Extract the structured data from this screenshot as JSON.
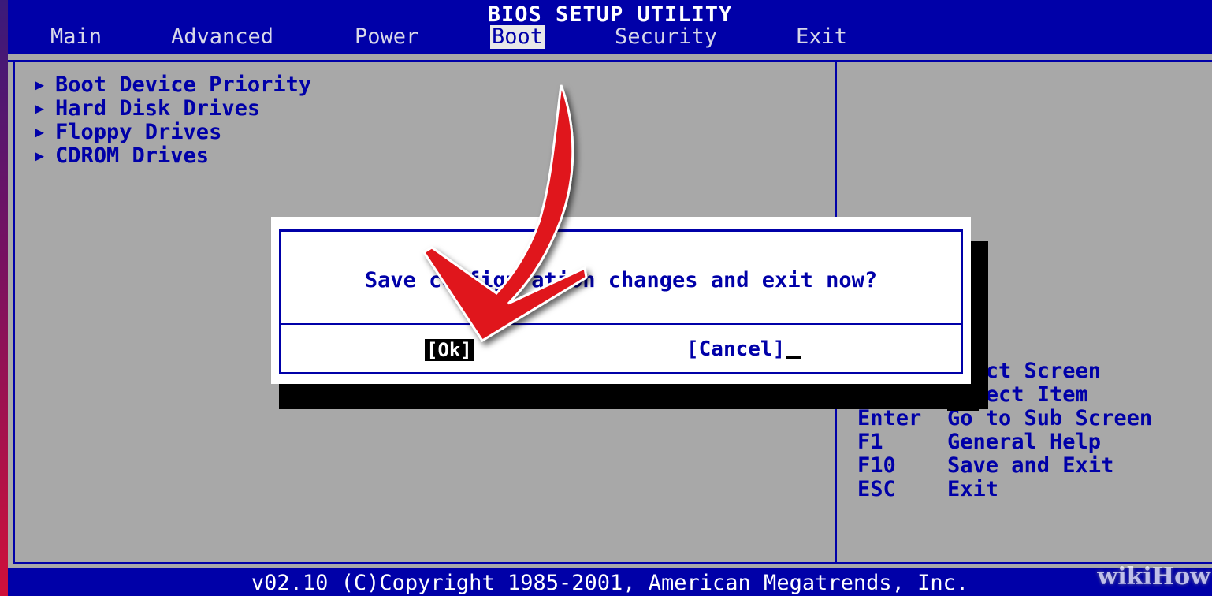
{
  "window": {
    "title": "BIOS SETUP UTILITY"
  },
  "menu": {
    "items": [
      {
        "label": "Main"
      },
      {
        "label": "Advanced"
      },
      {
        "label": "Power"
      },
      {
        "label": "Boot"
      },
      {
        "label": "Security"
      },
      {
        "label": "Exit"
      }
    ],
    "active": "Boot"
  },
  "boot_menu": {
    "items": [
      {
        "label": "Boot Device Priority"
      },
      {
        "label": "Hard Disk Drives"
      },
      {
        "label": "Floppy Drives"
      },
      {
        "label": "CDROM Drives"
      }
    ],
    "arrow_icon": "triangle-right-icon"
  },
  "help": {
    "rows": [
      {
        "key": "",
        "text": "elect Screen"
      },
      {
        "key": "↑↓",
        "text": "Select Item"
      },
      {
        "key": "Enter",
        "text": "Go to Sub Screen"
      },
      {
        "key": "F1",
        "text": "General Help"
      },
      {
        "key": "F10",
        "text": "Save and Exit"
      },
      {
        "key": "ESC",
        "text": "Exit"
      }
    ]
  },
  "dialog": {
    "message": "Save configuration changes and exit now?",
    "ok_label": "[Ok]",
    "cancel_label": "[Cancel]"
  },
  "footer": {
    "text": "v02.10 (C)Copyright 1985-2001, American Megatrends, Inc."
  },
  "watermark": {
    "text": "wikiHow"
  },
  "colors": {
    "bios_blue": "#0000a8",
    "panel_gray": "#a8a8a8",
    "annotation_red": "#e0141e"
  }
}
